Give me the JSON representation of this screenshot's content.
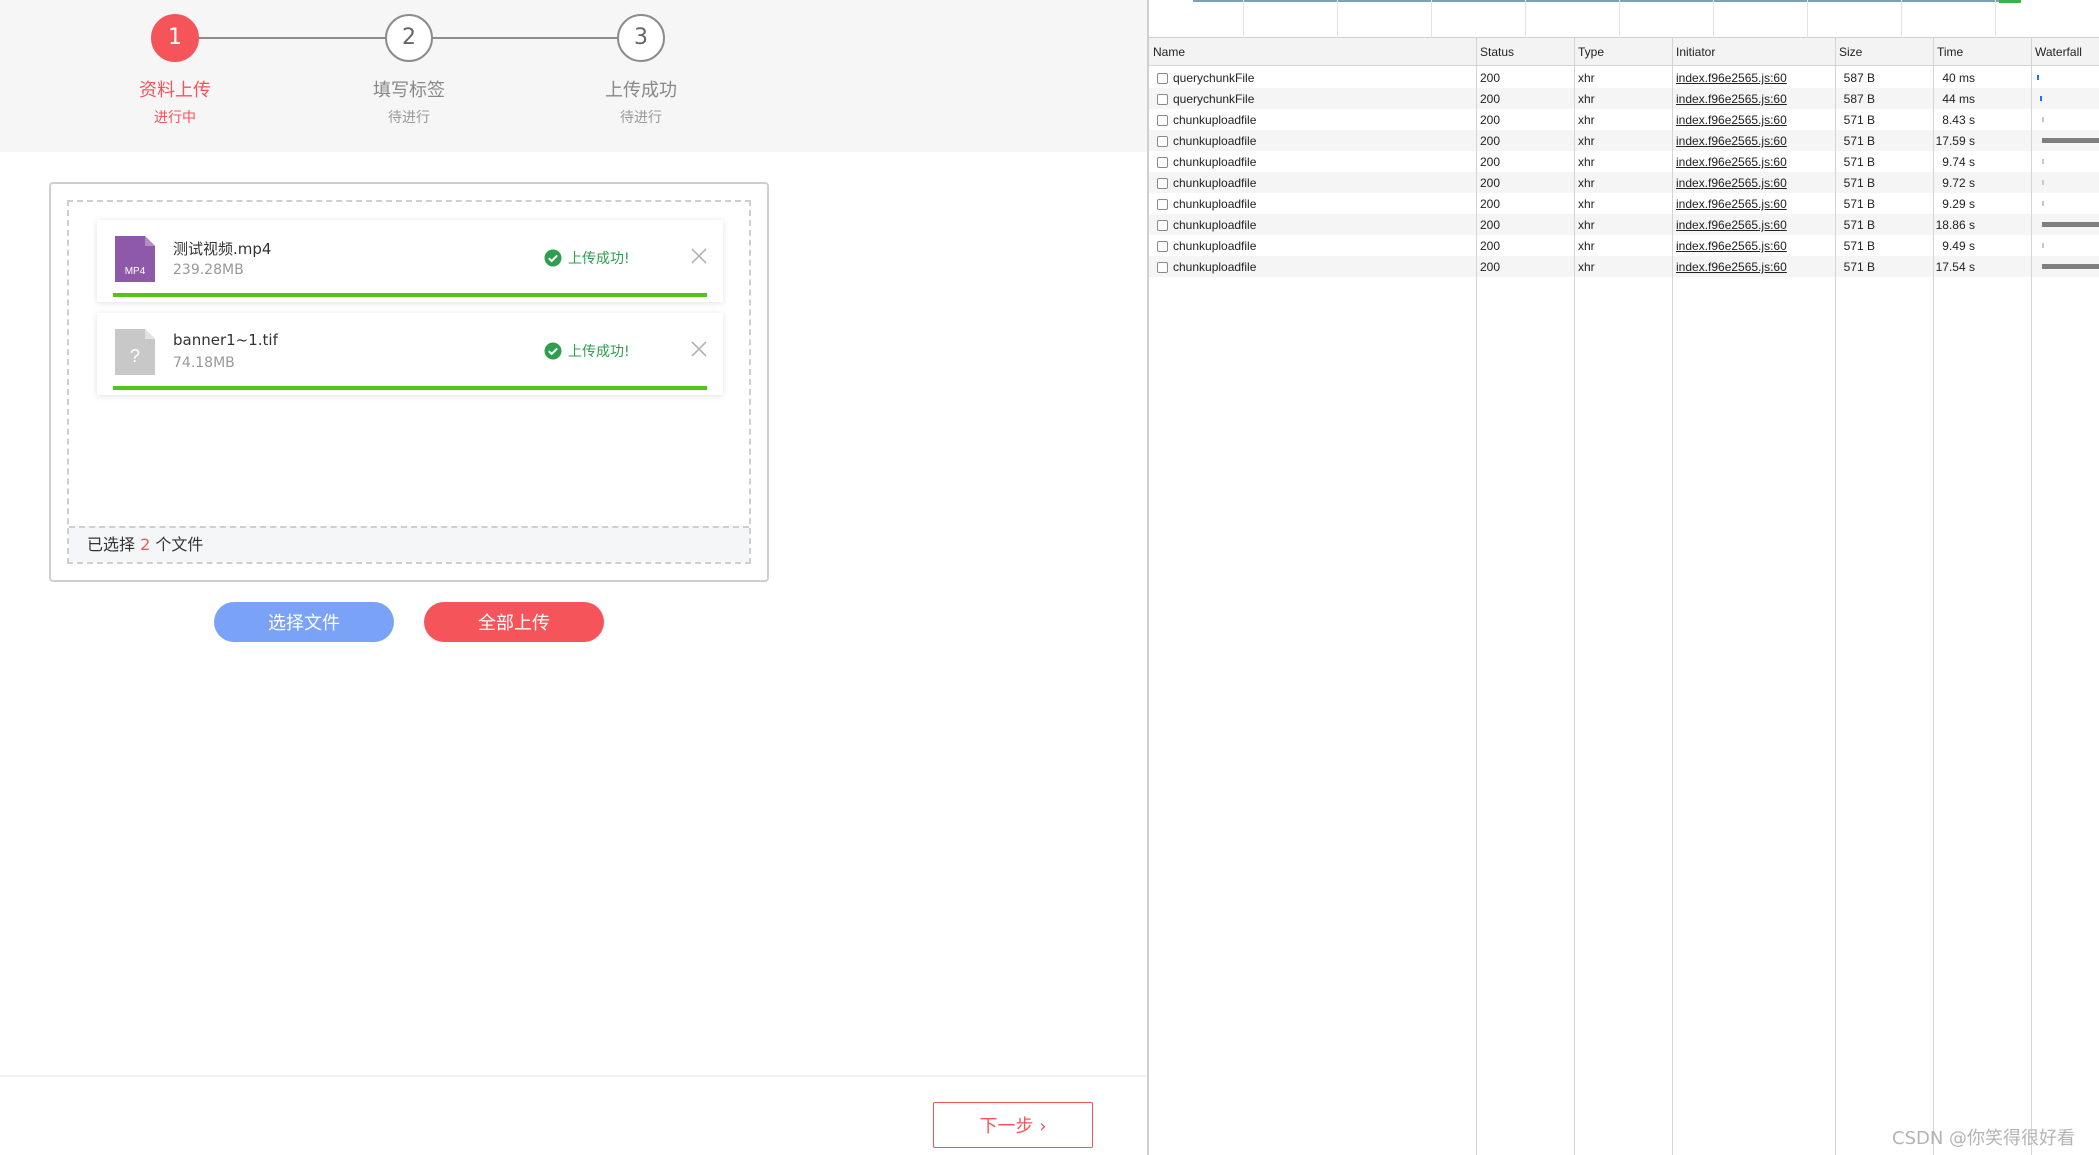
{
  "steps": [
    {
      "number": "1",
      "title": "资料上传",
      "sub": "进行中",
      "active": true
    },
    {
      "number": "2",
      "title": "填写标签",
      "sub": "待进行",
      "active": false
    },
    {
      "number": "3",
      "title": "上传成功",
      "sub": "待进行",
      "active": false
    }
  ],
  "files": [
    {
      "name": "测试视频.mp4",
      "size": "239.28MB",
      "icon": "mp4-file-icon",
      "icon_label": "MP4",
      "status": "上传成功!",
      "progress": 1.0
    },
    {
      "name": "banner1~1.tif",
      "size": "74.18MB",
      "icon": "unknown-file-icon",
      "icon_label": "?",
      "status": "上传成功!",
      "progress": 1.0
    }
  ],
  "summary": {
    "prefix": "已选择",
    "count": "2",
    "suffix": "个文件"
  },
  "buttons": {
    "select": "选择文件",
    "upload_all": "全部上传",
    "next": "下一步 ›"
  },
  "colors": {
    "accent": "#f5545a",
    "select_btn": "#7aa2f7",
    "success": "#2e9e4f",
    "progress": "#52c41a",
    "mp4_icon": "#8e59a8"
  },
  "devtools": {
    "columns": [
      "Name",
      "Status",
      "Type",
      "Initiator",
      "Size",
      "Time",
      "Waterfall"
    ],
    "rows": [
      {
        "name": "querychunkFile",
        "status": "200",
        "type": "xhr",
        "initiator": "index.f96e2565.js:60",
        "size": "587 B",
        "time": "40 ms"
      },
      {
        "name": "querychunkFile",
        "status": "200",
        "type": "xhr",
        "initiator": "index.f96e2565.js:60",
        "size": "587 B",
        "time": "44 ms"
      },
      {
        "name": "chunkuploadfile",
        "status": "200",
        "type": "xhr",
        "initiator": "index.f96e2565.js:60",
        "size": "571 B",
        "time": "8.43 s"
      },
      {
        "name": "chunkuploadfile",
        "status": "200",
        "type": "xhr",
        "initiator": "index.f96e2565.js:60",
        "size": "571 B",
        "time": "17.59 s"
      },
      {
        "name": "chunkuploadfile",
        "status": "200",
        "type": "xhr",
        "initiator": "index.f96e2565.js:60",
        "size": "571 B",
        "time": "9.74 s"
      },
      {
        "name": "chunkuploadfile",
        "status": "200",
        "type": "xhr",
        "initiator": "index.f96e2565.js:60",
        "size": "571 B",
        "time": "9.72 s"
      },
      {
        "name": "chunkuploadfile",
        "status": "200",
        "type": "xhr",
        "initiator": "index.f96e2565.js:60",
        "size": "571 B",
        "time": "9.29 s"
      },
      {
        "name": "chunkuploadfile",
        "status": "200",
        "type": "xhr",
        "initiator": "index.f96e2565.js:60",
        "size": "571 B",
        "time": "18.86 s"
      },
      {
        "name": "chunkuploadfile",
        "status": "200",
        "type": "xhr",
        "initiator": "index.f96e2565.js:60",
        "size": "571 B",
        "time": "9.49 s"
      },
      {
        "name": "chunkuploadfile",
        "status": "200",
        "type": "xhr",
        "initiator": "index.f96e2565.js:60",
        "size": "571 B",
        "time": "17.54 s"
      }
    ]
  },
  "watermark": "CSDN @你笑得很好看"
}
